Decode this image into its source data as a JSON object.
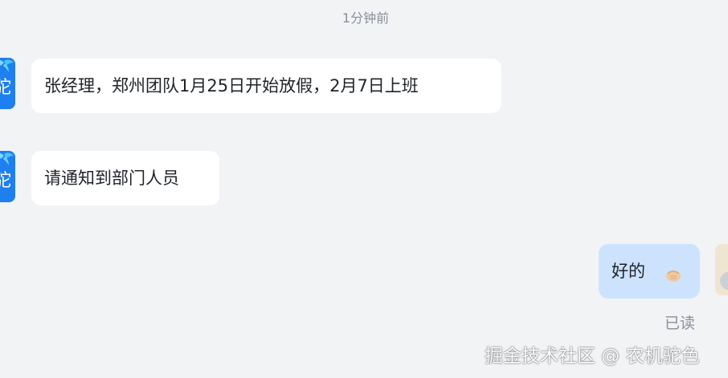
{
  "conversation": {
    "timestamp": "1分钟前",
    "messages": [
      {
        "sender": "other",
        "text": "张经理，郑州团队1月25日开始放假，2月7日上班"
      },
      {
        "sender": "other",
        "text": "请通知到部门人员"
      },
      {
        "sender": "me",
        "text": "好的",
        "emoji": "fist-bump-icon"
      }
    ],
    "read_status": "已读"
  },
  "avatars": {
    "left_label": "驼",
    "left_color": "#1e7ff0",
    "left_icon": "palm-tree-icon"
  },
  "watermark": "掘金技术社区 @ 农机驼色"
}
